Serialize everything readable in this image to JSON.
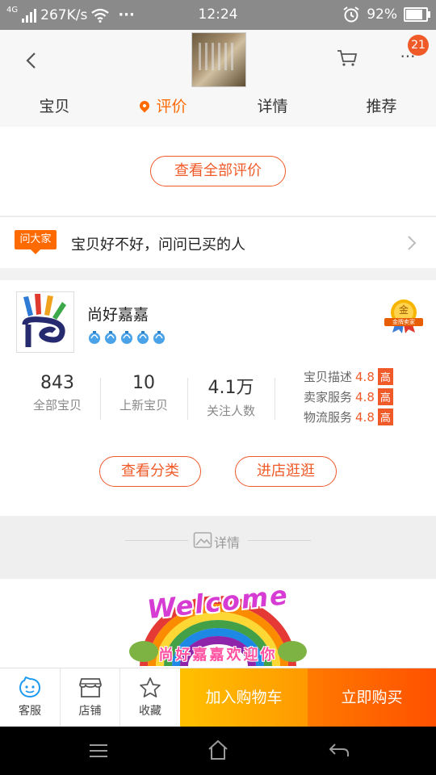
{
  "status_bar": {
    "network": "4G",
    "speed": "267K/s",
    "more": "···",
    "time": "12:24",
    "battery_percent": "92%",
    "battery_level": 0.92
  },
  "header": {
    "cart_badge": "21",
    "more_label": "···",
    "tabs": [
      {
        "label": "宝贝"
      },
      {
        "label": "评价"
      },
      {
        "label": "详情"
      },
      {
        "label": "推荐"
      }
    ],
    "active_tab": 1
  },
  "reviews": {
    "view_all_label": "查看全部评价"
  },
  "ask": {
    "tag": "问大家",
    "prompt": "宝贝好不好，问问已买的人"
  },
  "shop": {
    "name": "尚好嘉嘉",
    "crown_count": 5,
    "gold_badge_top": "金",
    "gold_badge_bottom": "金牌卖家",
    "stats": [
      {
        "value": "843",
        "label": "全部宝贝"
      },
      {
        "value": "10",
        "label": "上新宝贝"
      },
      {
        "value": "4.1万",
        "label": "关注人数"
      }
    ],
    "ratings": [
      {
        "label": "宝贝描述",
        "score": "4.8",
        "level": "高"
      },
      {
        "label": "卖家服务",
        "score": "4.8",
        "level": "高"
      },
      {
        "label": "物流服务",
        "score": "4.8",
        "level": "高"
      }
    ],
    "category_button": "查看分类",
    "visit_button": "进店逛逛"
  },
  "details": {
    "divider_label": "详情",
    "banner_title": "Welcome",
    "banner_text": "尚好嘉嘉欢迎你"
  },
  "bottom_bar": {
    "service": "客服",
    "store": "店铺",
    "favorite": "收藏",
    "add_to_cart": "加入购物车",
    "buy_now": "立即购买"
  },
  "colors": {
    "accent": "#f05a28",
    "tab_active": "#ff6a00",
    "cart_button": "#ffaa00",
    "buy_button": "#ff5a00"
  }
}
